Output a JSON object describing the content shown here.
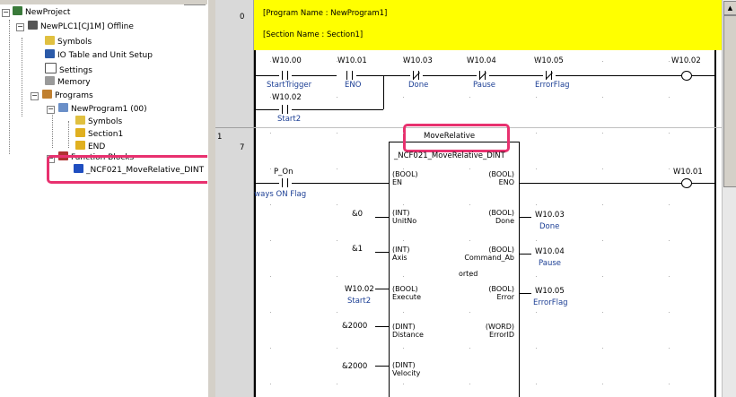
{
  "tree": {
    "project": "NewProject",
    "plc": "NewPLC1[CJ1M] Offline",
    "items": {
      "symbols": "Symbols",
      "io_table": "IO Table and Unit Setup",
      "settings": "Settings",
      "memory": "Memory",
      "programs": "Programs",
      "program1": "NewProgram1 (00)",
      "prog_symbols": "Symbols",
      "section1": "Section1",
      "end": "END",
      "function_blocks": "Function Blocks",
      "fb_instance": "_NCF021_MoveRelative_DINT"
    }
  },
  "rungs": {
    "r0_number": "0",
    "r1_left": "1",
    "r1_number": "7"
  },
  "header": {
    "program_name": "[Program Name : NewProgram1]",
    "section_name": "[Section Name : Section1]"
  },
  "rung0": {
    "c1_addr": "W10.00",
    "c1_name": "StartTrigger",
    "c2_addr": "W10.01",
    "c2_name": "ENO",
    "c3_addr": "W10.03",
    "c3_name": "Done",
    "c4_addr": "W10.04",
    "c4_name": "Pause",
    "c5_addr": "W10.05",
    "c5_name": "ErrorFlag",
    "coil_addr": "W10.02",
    "b_addr": "W10.02",
    "b_name": "Start2"
  },
  "rung1": {
    "instance": "MoveRelative",
    "fb_name": "_NCF021_MoveRelative_DINT",
    "in_contact_addr": "P_On",
    "in_contact_name": "Always ON Flag",
    "coil_addr": "W10.01",
    "inputs": [
      {
        "type": "(BOOL)",
        "name": "EN",
        "value": "",
        "value_name": ""
      },
      {
        "type": "(INT)",
        "name": "UnitNo",
        "value": "&0",
        "value_name": ""
      },
      {
        "type": "(INT)",
        "name": "Axis",
        "value": "&1",
        "value_name": ""
      },
      {
        "type": "(BOOL)",
        "name": "Execute",
        "value": "W10.02",
        "value_name": "Start2"
      },
      {
        "type": "(DINT)",
        "name": "Distance",
        "value": "&2000",
        "value_name": ""
      },
      {
        "type": "(DINT)",
        "name": "Velocity",
        "value": "&2000",
        "value_name": ""
      }
    ],
    "outputs": [
      {
        "type": "(BOOL)",
        "name": "ENO",
        "value": "",
        "value_name": ""
      },
      {
        "type": "(BOOL)",
        "name": "Done",
        "value": "W10.03",
        "value_name": "Done"
      },
      {
        "type": "(BOOL)",
        "name": "Command_Ab",
        "name2": "orted",
        "value": "W10.04",
        "value_name": "Pause"
      },
      {
        "type": "(BOOL)",
        "name": "Error",
        "value": "W10.05",
        "value_name": "ErrorFlag"
      },
      {
        "type": "(WORD)",
        "name": "ErrorID",
        "value": "",
        "value_name": ""
      }
    ]
  },
  "colors": {
    "header_yellow": "#ffff00",
    "highlight": "#e8316f",
    "link_blue": "#1c3f95"
  }
}
